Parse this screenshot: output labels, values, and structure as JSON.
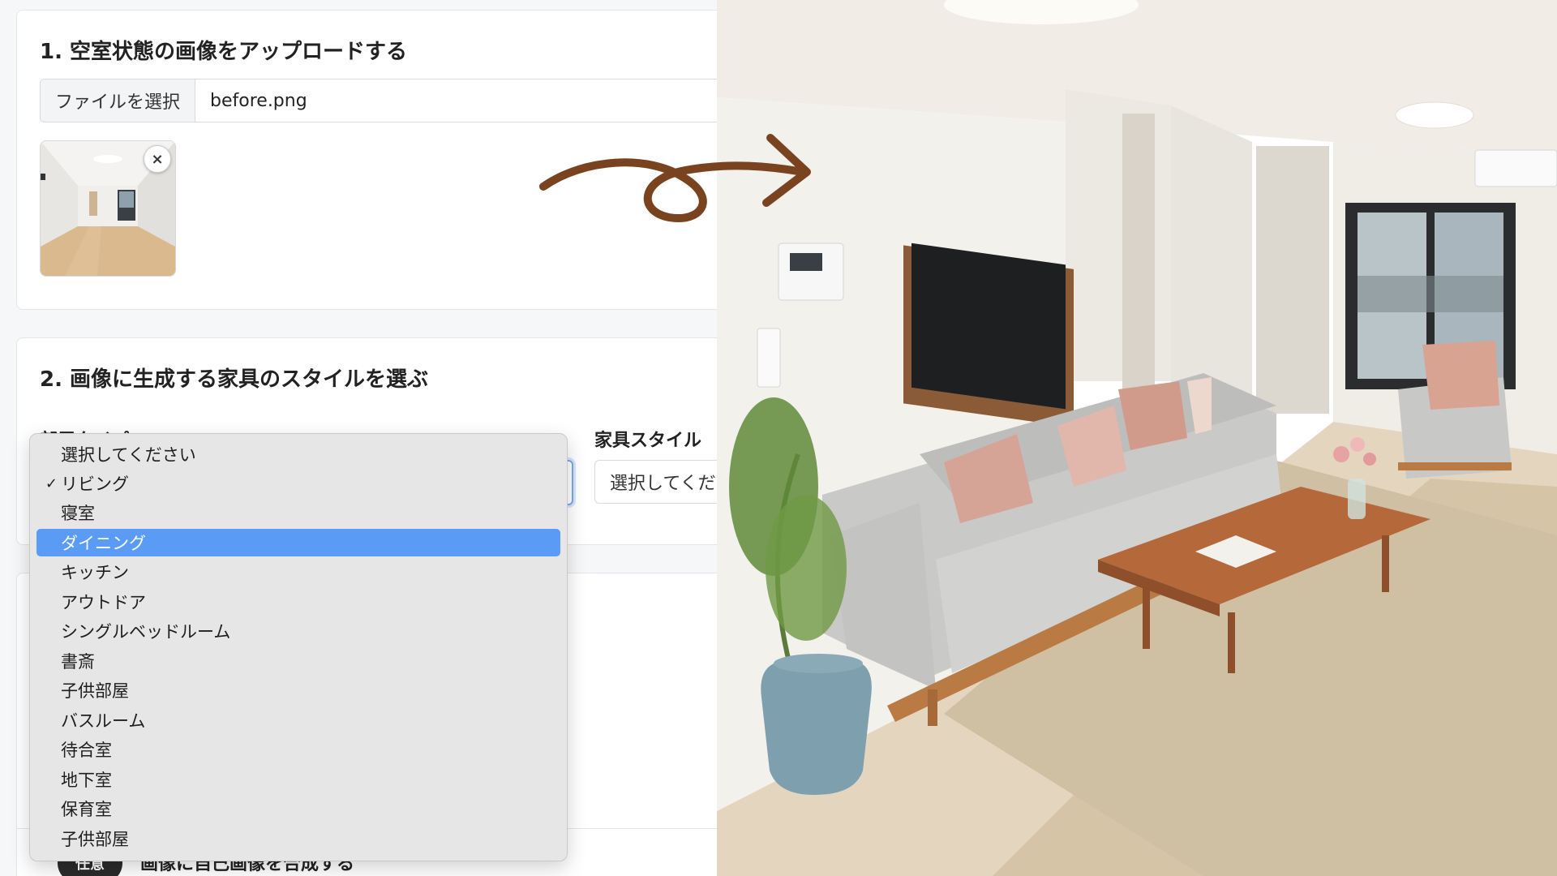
{
  "section1": {
    "title": "1. 空室状態の画像をアップロードする",
    "file_button": "ファイルを選択",
    "file_name": "before.png",
    "remove_icon": "×"
  },
  "section2": {
    "title": "2. 画像に生成する家具のスタイルを選ぶ",
    "room_type_label": "部屋タイプ",
    "furniture_style_label": "家具スタイル",
    "furniture_style_value": "選択してくだ"
  },
  "section3": {
    "badge": "任意",
    "title": "画像に自己画像を合成する"
  },
  "dropdown": {
    "options": [
      {
        "label": "選択してください",
        "checked": false,
        "highlighted": false
      },
      {
        "label": "リビング",
        "checked": true,
        "highlighted": false
      },
      {
        "label": "寝室",
        "checked": false,
        "highlighted": false
      },
      {
        "label": "ダイニング",
        "checked": false,
        "highlighted": true
      },
      {
        "label": "キッチン",
        "checked": false,
        "highlighted": false
      },
      {
        "label": "アウトドア",
        "checked": false,
        "highlighted": false
      },
      {
        "label": "シングルベッドルーム",
        "checked": false,
        "highlighted": false
      },
      {
        "label": "書斎",
        "checked": false,
        "highlighted": false
      },
      {
        "label": "子供部屋",
        "checked": false,
        "highlighted": false
      },
      {
        "label": "バスルーム",
        "checked": false,
        "highlighted": false
      },
      {
        "label": "待合室",
        "checked": false,
        "highlighted": false
      },
      {
        "label": "地下室",
        "checked": false,
        "highlighted": false
      },
      {
        "label": "保育室",
        "checked": false,
        "highlighted": false
      },
      {
        "label": "子供部屋",
        "checked": false,
        "highlighted": false
      }
    ],
    "check_glyph": "✓"
  },
  "colors": {
    "highlight": "#5a9cf5",
    "arrow": "#7a4320",
    "focus_border": "#7aa7ee"
  }
}
